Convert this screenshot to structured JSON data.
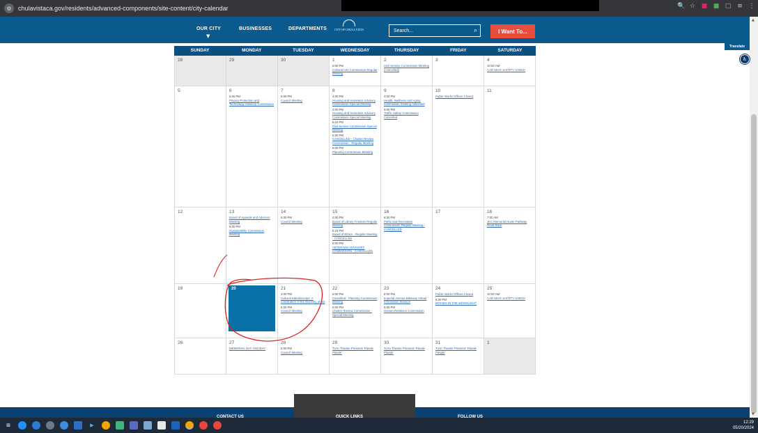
{
  "browser": {
    "url": "chulavistaca.gov/residents/advanced-components/site-content/city-calendar",
    "site_info_icon": "site-info-icon",
    "action_icons": [
      "zoom-icon",
      "star-icon",
      "extension-icon",
      "extension-icon",
      "extension-icon",
      "sidebar-icon",
      "menu-icon"
    ]
  },
  "nav": {
    "our_city": "OUR CITY",
    "businesses": "BUSINESSES",
    "departments": "DEPARTMENTS",
    "logo_text": "CITY OF CHULA VISTA",
    "search_placeholder": "Search...",
    "want_label": "I Want To..."
  },
  "side": {
    "translate": "Translate"
  },
  "calendar": {
    "days_of_week": [
      "SUNDAY",
      "MONDAY",
      "TUESDAY",
      "WEDNESDAY",
      "THURSDAY",
      "FRIDAY",
      "SATURDAY"
    ],
    "weeks": [
      {
        "days": [
          {
            "num": "28",
            "other": true,
            "events": []
          },
          {
            "num": "29",
            "other": true,
            "events": []
          },
          {
            "num": "30",
            "other": true,
            "events": []
          },
          {
            "num": "1",
            "events": [
              {
                "time": "6:00 PM",
                "title": "Cultural Arts Commission Regular Meeting"
              }
            ]
          },
          {
            "num": "2",
            "events": [
              {
                "time": "",
                "title": "Civil Service Commission Meeting (Cancelled)"
              }
            ]
          },
          {
            "num": "3",
            "events": []
          },
          {
            "num": "4",
            "events": [
              {
                "time": "10:00 AM",
                "title": "CAR SEAT SAFETY CHECK"
              }
            ]
          }
        ]
      },
      {
        "days": [
          {
            "num": "5",
            "events": []
          },
          {
            "num": "6",
            "events": [
              {
                "time": "5:00 PM",
                "title": "Privacy Protection and Technology Advisory Commission"
              }
            ]
          },
          {
            "num": "7",
            "events": [
              {
                "time": "5:00 PM",
                "title": "Council Meeting"
              }
            ]
          },
          {
            "num": "8",
            "events": [
              {
                "time": "4:00 PM",
                "title": "Housing and Homeless Advisory Commission Special Meeting"
              },
              {
                "time": "4:00 PM",
                "title": "Housing and Homeless Advisory Commission Special Meeting"
              },
              {
                "time": "5:15 PM",
                "title": "Civil Service Commission Special Meeting"
              },
              {
                "time": "6:00 PM",
                "title": "CANCELLED - Charter Review Commission - Regular Meeting"
              },
              {
                "time": "6:00 PM",
                "title": "Planning Commission Meeting"
              }
            ]
          },
          {
            "num": "9",
            "events": [
              {
                "time": "4:00 PM",
                "title": "Health, Wellness and Aging commission meeting cancelled"
              },
              {
                "time": "6:00 PM",
                "title": "Traffic Safety Commission Cancelled"
              }
            ]
          },
          {
            "num": "10",
            "events": [
              {
                "time": "",
                "title": "Public Works Offices Closed"
              }
            ]
          },
          {
            "num": "11",
            "events": []
          }
        ]
      },
      {
        "days": [
          {
            "num": "12",
            "events": []
          },
          {
            "num": "13",
            "events": [
              {
                "time": "",
                "title": "Board of Appeals and Advisors Meeting"
              },
              {
                "time": "5:00 PM",
                "title": "Sustainability Commission Meeting"
              }
            ]
          },
          {
            "num": "14",
            "events": [
              {
                "time": "5:00 PM",
                "title": "Council Meeting"
              }
            ]
          },
          {
            "num": "15",
            "events": [
              {
                "time": "4:00 PM",
                "title": "Board of Library Trustees Regular Meeting"
              },
              {
                "time": "5:15 PM",
                "title": "Board of Ethics - Regular Meeting - CANCELLED"
              },
              {
                "time": "6:00 PM",
                "title": "VETERANS ADVISORY COMMISSION - CANCELLED"
              }
            ]
          },
          {
            "num": "16",
            "events": [
              {
                "time": "6:30 PM",
                "title": "Parks and Recreation Commission Regular Meeting - CANCELLED"
              }
            ]
          },
          {
            "num": "17",
            "events": []
          },
          {
            "num": "18",
            "events": [
              {
                "time": "7:00 AM",
                "title": "JKC Memorial Hunte Parkway Road Race"
              }
            ]
          }
        ]
      },
      {
        "days": [
          {
            "num": "19",
            "events": []
          },
          {
            "num": "20",
            "today": true,
            "events": []
          },
          {
            "num": "21",
            "events": [
              {
                "time": "4:00 PM",
                "title": "Cultural Kaleidoscope: A Celebration of the Diversity of SD"
              },
              {
                "time": "5:00 PM",
                "title": "Council Meeting"
              }
            ]
          },
          {
            "num": "22",
            "events": [
              {
                "time": "6:00 PM",
                "title": "Cancelled - Planning Commission Meeting"
              },
              {
                "time": "6:00 PM",
                "title": "Charter Review Commission - Special Meeting"
              }
            ]
          },
          {
            "num": "23",
            "events": [
              {
                "time": "6:00 PM",
                "title": "Imperial Avenue Bikeway Virtual Information Session"
              },
              {
                "time": "6:00 PM",
                "title": "Human Relations Commission"
              }
            ]
          },
          {
            "num": "24",
            "events": [
              {
                "time": "",
                "title": "Public Works Offices Closed"
              },
              {
                "time": "6:00 PM",
                "title": "MOVIES IN THE MOONLIGHT"
              }
            ]
          },
          {
            "num": "25",
            "events": [
              {
                "time": "10:00 AM",
                "title": "CAR SEAT SAFETY CHECK"
              }
            ]
          }
        ]
      },
      {
        "days": [
          {
            "num": "26",
            "events": []
          },
          {
            "num": "27",
            "events": [
              {
                "time": "",
                "title": "MEMORIAL DAY HOLIDAY"
              }
            ]
          },
          {
            "num": "28",
            "events": [
              {
                "time": "5:00 PM",
                "title": "Council Meeting"
              }
            ]
          },
          {
            "num": "29",
            "events": [
              {
                "time": "",
                "title": "TuYo Theatre Presents 'Pásale Pásale'"
              }
            ]
          },
          {
            "num": "30",
            "events": [
              {
                "time": "",
                "title": "TuYo Theatre Presents 'Pásale Pásale'"
              }
            ]
          },
          {
            "num": "31",
            "events": [
              {
                "time": "",
                "title": "TuYo Theatre Presents 'Pásale Pásale'"
              }
            ]
          },
          {
            "num": "1",
            "other": true,
            "events": []
          }
        ]
      }
    ]
  },
  "footer": {
    "contact": "CONTACT US",
    "quick_links": "QUICK LINKS",
    "follow": "FOLLOW US"
  },
  "taskbar": {
    "time": "12:29",
    "date": "05/20/2024"
  },
  "colors": {
    "nav_blue": "#0b5a8e",
    "header_blue": "#0b4f80",
    "today_blue": "#0a70a8",
    "link_blue": "#2a6bb8",
    "want_red": "#e74c3c",
    "annotation_red": "#e0231d"
  }
}
